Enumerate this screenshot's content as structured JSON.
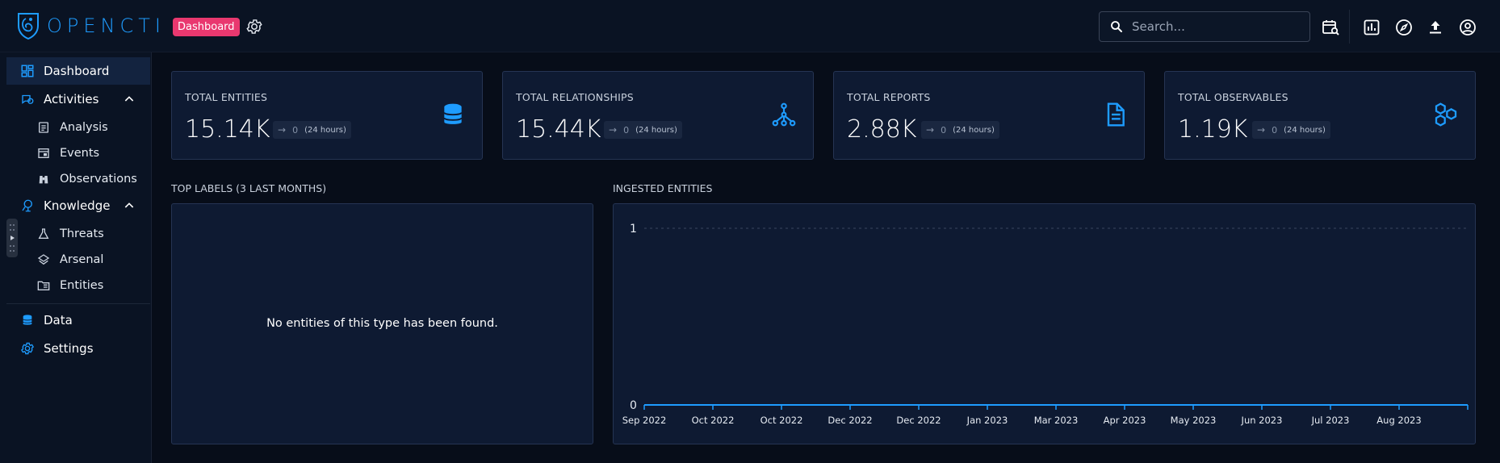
{
  "app": {
    "logo_text": "OPENCTI",
    "badge": "Dashboard",
    "search_placeholder": "Search..."
  },
  "sidebar": {
    "items": [
      {
        "label": "Dashboard"
      },
      {
        "label": "Activities"
      },
      {
        "label": "Analysis"
      },
      {
        "label": "Events"
      },
      {
        "label": "Observations"
      },
      {
        "label": "Knowledge"
      },
      {
        "label": "Threats"
      },
      {
        "label": "Arsenal"
      },
      {
        "label": "Entities"
      },
      {
        "label": "Data"
      },
      {
        "label": "Settings"
      }
    ]
  },
  "cards": [
    {
      "title": "TOTAL ENTITIES",
      "value": "15.14K",
      "delta": "0",
      "period": "(24 hours)",
      "icon": "database-icon"
    },
    {
      "title": "TOTAL RELATIONSHIPS",
      "value": "15.44K",
      "delta": "0",
      "period": "(24 hours)",
      "icon": "graph-outline-icon"
    },
    {
      "title": "TOTAL REPORTS",
      "value": "2.88K",
      "delta": "0",
      "period": "(24 hours)",
      "icon": "file-document-icon"
    },
    {
      "title": "TOTAL OBSERVABLES",
      "value": "1.19K",
      "delta": "0",
      "period": "(24 hours)",
      "icon": "hexagon-multiple-icon"
    }
  ],
  "top_labels": {
    "title": "TOP LABELS (3 LAST MONTHS)",
    "empty_message": "No entities of this type has been found."
  },
  "ingested": {
    "title": "INGESTED ENTITIES"
  },
  "colors": {
    "accent": "#1e9cff",
    "badge": "#e9386f",
    "background": "#070d19",
    "panel": "#0e1a32"
  },
  "chart_data": {
    "type": "area",
    "title": "INGESTED ENTITIES",
    "categories": [
      "Sep 2022",
      "Oct 2022",
      "Oct 2022",
      "Dec 2022",
      "Dec 2022",
      "Jan 2023",
      "Mar 2023",
      "Apr 2023",
      "May 2023",
      "Jun 2023",
      "Jul 2023",
      "Aug 2023"
    ],
    "values": [
      0,
      0,
      0,
      0,
      0,
      0,
      0,
      0,
      0,
      0,
      0,
      0
    ],
    "y_ticks": [
      "0",
      "1"
    ],
    "ylim": [
      0,
      1
    ],
    "grid": true
  }
}
